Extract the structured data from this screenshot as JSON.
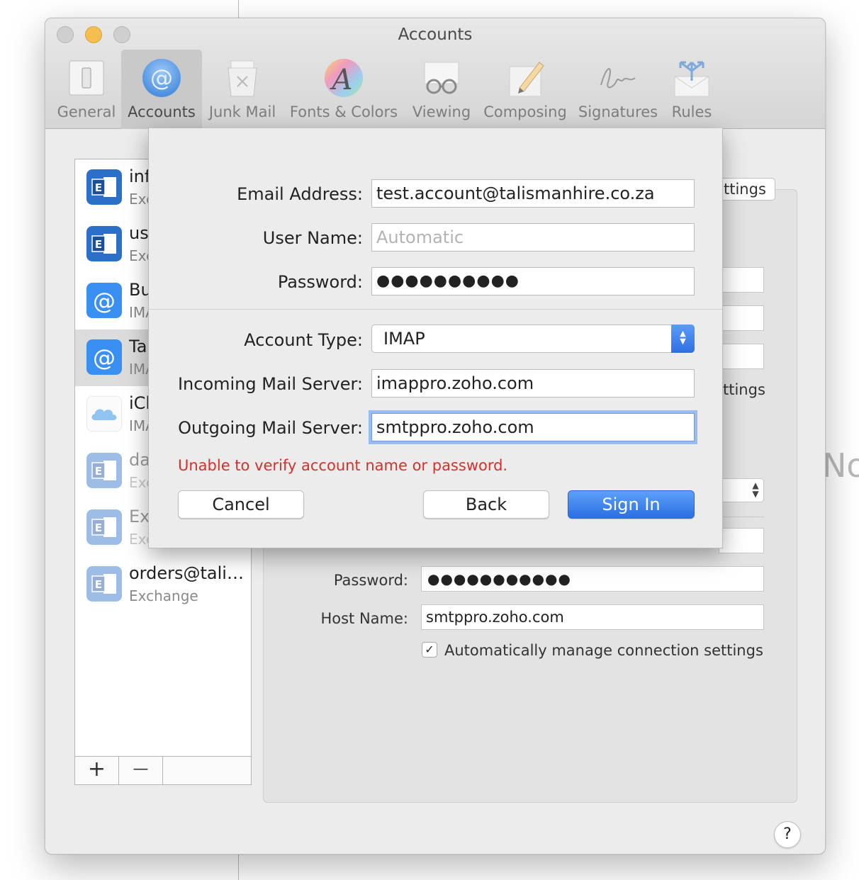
{
  "window": {
    "title": "Accounts"
  },
  "toolbar": {
    "items": [
      {
        "label": "General",
        "icon": "general-switch-icon"
      },
      {
        "label": "Accounts",
        "icon": "at-sign-icon",
        "selected": true
      },
      {
        "label": "Junk Mail",
        "icon": "trash-bin-icon"
      },
      {
        "label": "Fonts & Colors",
        "icon": "fonts-colors-icon"
      },
      {
        "label": "Viewing",
        "icon": "glasses-icon"
      },
      {
        "label": "Composing",
        "icon": "pencil-paper-icon"
      },
      {
        "label": "Signatures",
        "icon": "signature-icon"
      },
      {
        "label": "Rules",
        "icon": "rules-envelope-icon"
      }
    ]
  },
  "accounts": {
    "items": [
      {
        "name": "inf",
        "type": "Exc",
        "icon": "exchange-icon"
      },
      {
        "name": "us",
        "type": "Exc",
        "icon": "exchange-icon"
      },
      {
        "name": "Bu",
        "type": "IMA",
        "icon": "imap-at-icon"
      },
      {
        "name": "Ta",
        "type": "IMA",
        "icon": "imap-at-icon",
        "selected": true
      },
      {
        "name": "iCl",
        "type": "IMA",
        "icon": "icloud-icon"
      },
      {
        "name": "da",
        "type": "Exc",
        "icon": "exchange-icon",
        "disabled": true
      },
      {
        "name": "Ex",
        "type": "Exc",
        "icon": "exchange-icon",
        "disabled": true
      },
      {
        "name": "orders@tali…",
        "type": "Exchange",
        "icon": "exchange-icon",
        "disabled": true
      }
    ],
    "add_label": "+",
    "remove_label": "—"
  },
  "background": {
    "tab_text": "ttings",
    "checkbox_label_partial": "ttings",
    "ghost_text": "No",
    "password_label": "Password:",
    "password_value": "●●●●●●●●●●●",
    "host_label": "Host Name:",
    "host_value": "smtppro.zoho.com",
    "auto_manage_label": "Automatically manage connection settings",
    "help_label": "?"
  },
  "sheet": {
    "email_label": "Email Address:",
    "email_value": "test.account@talismanhire.co.za",
    "username_label": "User Name:",
    "username_placeholder": "Automatic",
    "password_label": "Password:",
    "password_value": "●●●●●●●●●●",
    "account_type_label": "Account Type:",
    "account_type_value": "IMAP",
    "incoming_label": "Incoming Mail Server:",
    "incoming_value": "imappro.zoho.com",
    "outgoing_label": "Outgoing Mail Server:",
    "outgoing_value": "smtppro.zoho.com",
    "error_text": "Unable to verify account name or password.",
    "cancel_label": "Cancel",
    "back_label": "Back",
    "signin_label": "Sign In"
  },
  "colors": {
    "accent": "#2f6fe2",
    "error": "#d6302a"
  }
}
